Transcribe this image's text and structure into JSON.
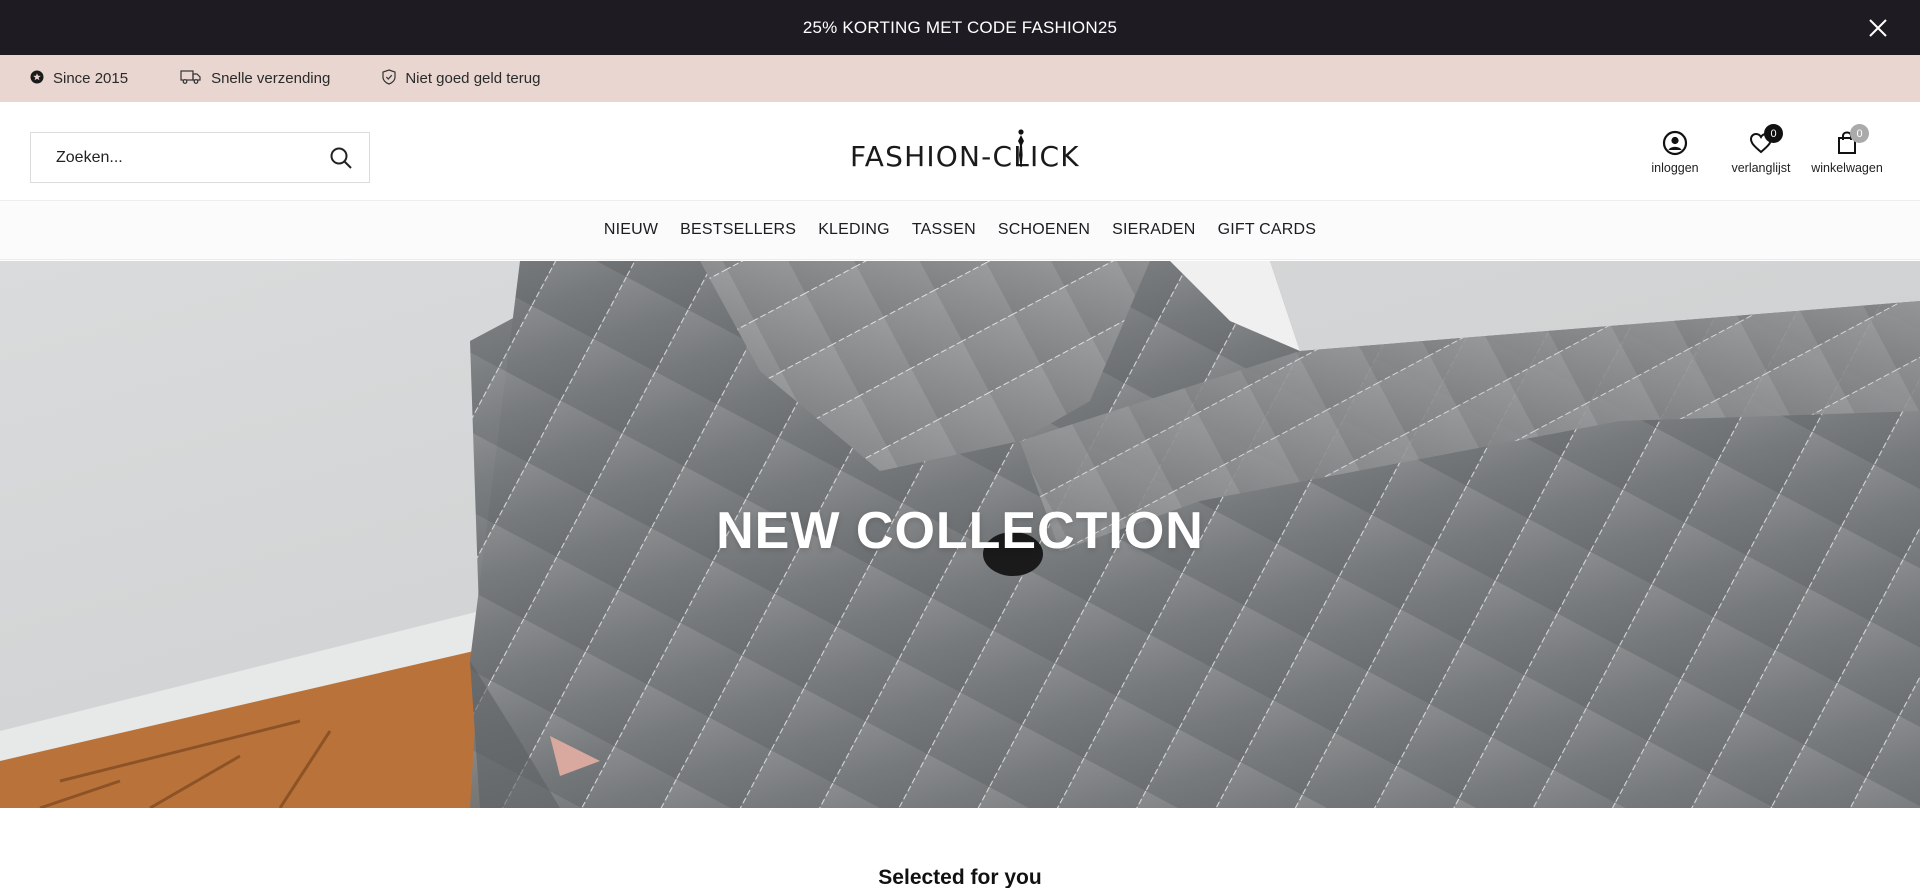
{
  "announcement": {
    "text": "25% KORTING MET CODE FASHION25"
  },
  "usp_bar": {
    "items": [
      {
        "label": "Since 2015",
        "icon": "badge-star-icon"
      },
      {
        "label": "Snelle verzending",
        "icon": "truck-icon"
      },
      {
        "label": "Niet goed geld terug",
        "icon": "shield-check-icon"
      }
    ]
  },
  "header": {
    "search": {
      "placeholder": "Zoeken..."
    },
    "logo": "FASHION-CLICK",
    "icons": {
      "login": {
        "label": "inloggen"
      },
      "wishlist": {
        "label": "verlanglijst",
        "count": "0"
      },
      "cart": {
        "label": "winkelwagen",
        "count": "0"
      }
    }
  },
  "nav": {
    "items": [
      "NIEUW",
      "BESTSELLERS",
      "KLEDING",
      "TASSEN",
      "SCHOENEN",
      "SIERADEN",
      "GIFT CARDS"
    ]
  },
  "hero": {
    "title": "NEW COLLECTION"
  },
  "sections": {
    "selected_title": "Selected for you"
  },
  "colors": {
    "announcement_bg": "#1e1c22",
    "usp_bg": "#e9d6d0",
    "nav_bg": "#fbfbfb"
  }
}
